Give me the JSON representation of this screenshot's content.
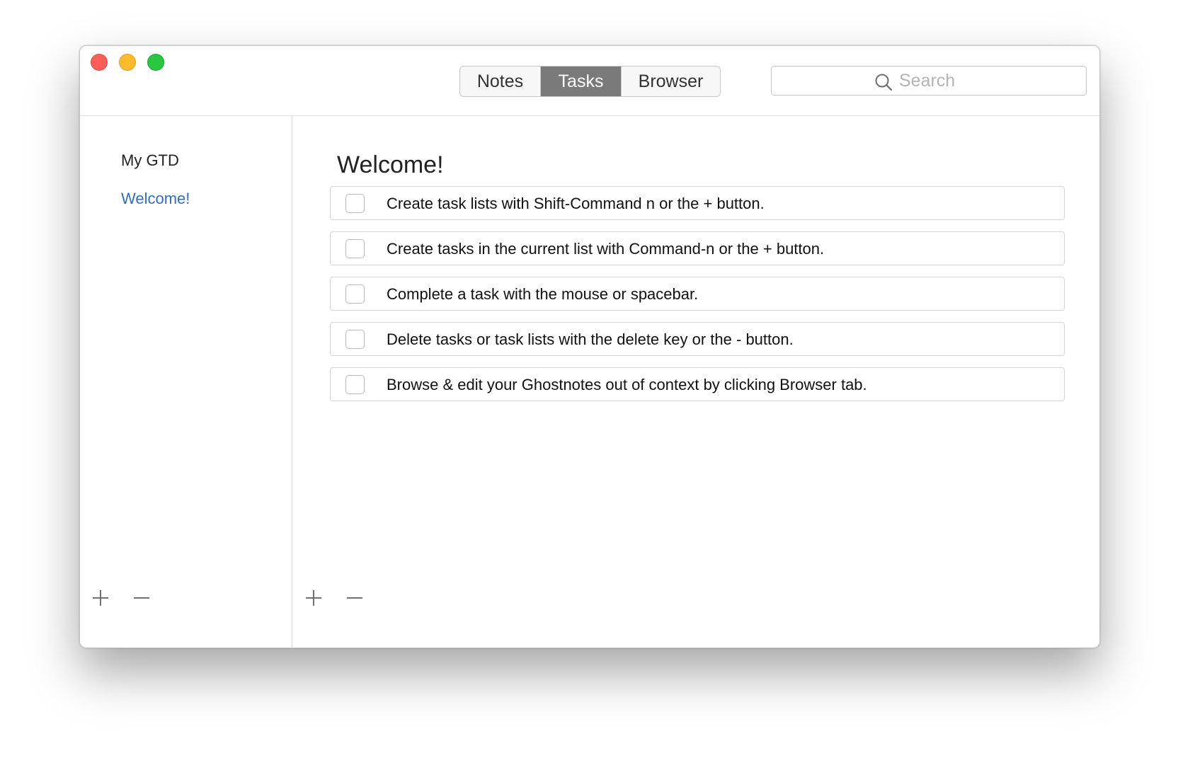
{
  "window": {
    "controls": [
      "close",
      "minimize",
      "zoom"
    ]
  },
  "toolbar": {
    "tabs": [
      {
        "label": "Notes",
        "selected": false
      },
      {
        "label": "Tasks",
        "selected": true
      },
      {
        "label": "Browser",
        "selected": false
      }
    ],
    "search": {
      "placeholder": "Search",
      "value": "",
      "icon": "search-icon"
    }
  },
  "sidebar": {
    "heading": "My GTD",
    "items": [
      {
        "label": "Welcome!",
        "selected": true
      }
    ],
    "add_icon": "plus-icon",
    "remove_icon": "minus-icon"
  },
  "main": {
    "title": "Welcome!",
    "tasks": [
      {
        "text": "Create task lists with Shift-Command n or the + button.",
        "done": false
      },
      {
        "text": "Create tasks in the current list with Command-n or the + button.",
        "done": false
      },
      {
        "text": "Complete a task with the mouse or spacebar.",
        "done": false
      },
      {
        "text": "Delete tasks or task lists with the delete key or the - button.",
        "done": false
      },
      {
        "text": "Browse & edit your Ghostnotes out of context by clicking Browser tab.",
        "done": false
      }
    ],
    "add_icon": "plus-icon",
    "remove_icon": "minus-icon"
  },
  "colors": {
    "close": "#fc5f57",
    "minimize": "#fdbc2e",
    "zoom": "#28c840",
    "selected_tab": "#7a7a7a",
    "link": "#2f6fc1"
  }
}
